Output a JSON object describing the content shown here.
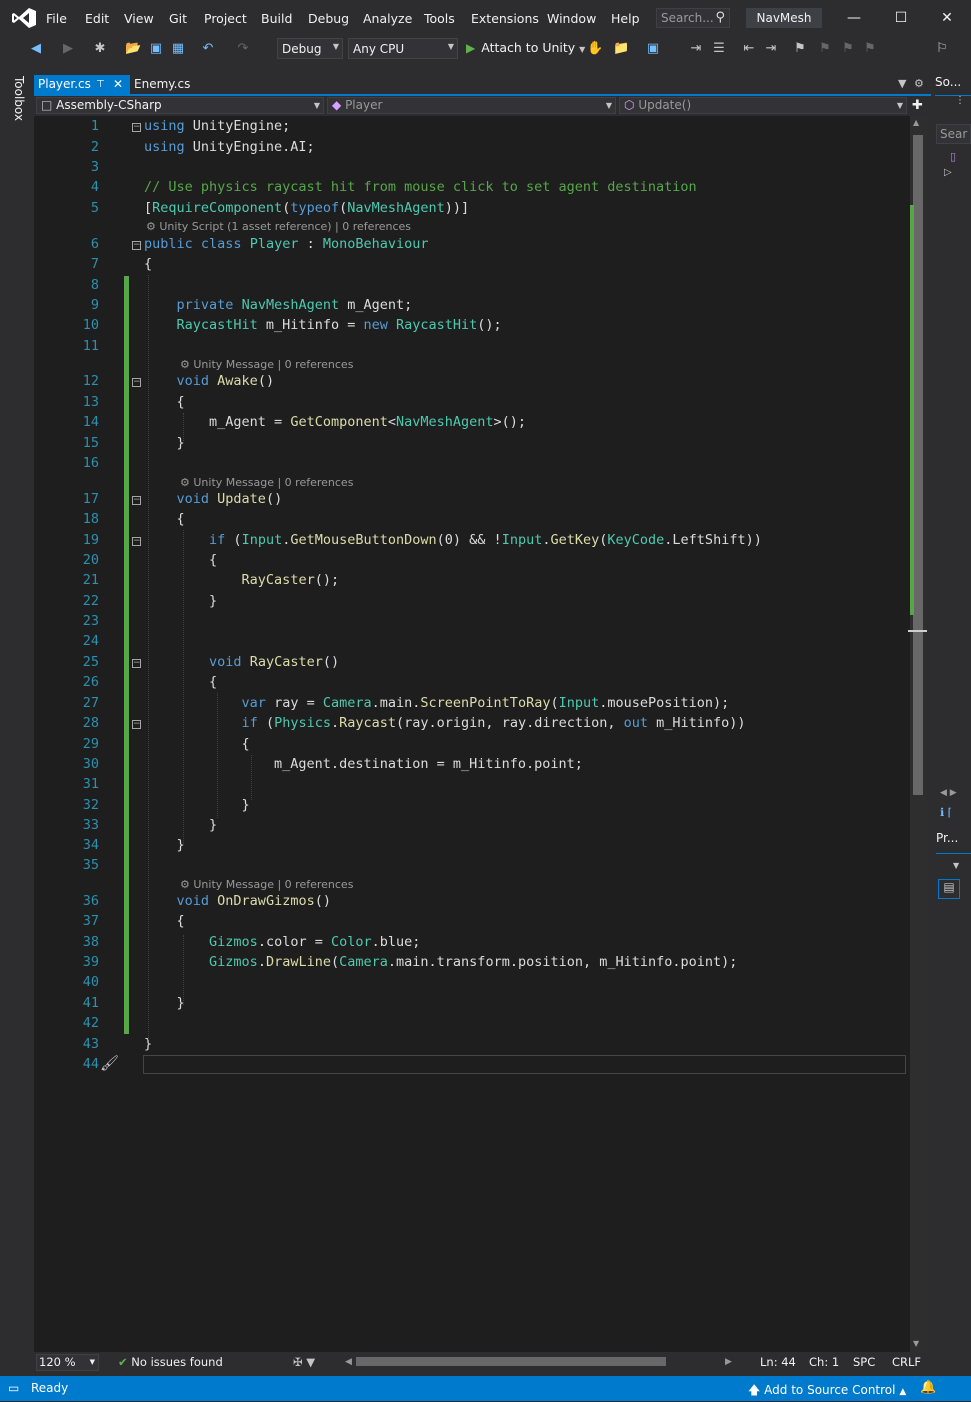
{
  "menu": [
    "File",
    "Edit",
    "View",
    "Git",
    "Project",
    "Build",
    "Debug",
    "Analyze",
    "Tools",
    "Extensions",
    "Window",
    "Help"
  ],
  "search_placeholder": "Search...",
  "solution_name": "NavMesh",
  "toolbar": {
    "config": "Debug",
    "platform": "Any CPU",
    "attach": "Attach to Unity"
  },
  "toolbox_label": "Toolbox",
  "tabs": [
    {
      "label": "Player.cs",
      "active": true
    },
    {
      "label": "Enemy.cs",
      "active": false
    }
  ],
  "navbar": {
    "project": "Assembly-CSharp",
    "type": "Player",
    "member": "Update()"
  },
  "code_lines": [
    "using UnityEngine;",
    "using UnityEngine.AI;",
    "",
    "// Use physics raycast hit from mouse click to set agent destination",
    "[RequireComponent(typeof(NavMeshAgent))]",
    "public class Player : MonoBehaviour",
    "{",
    "",
    "    private NavMeshAgent m_Agent;",
    "    RaycastHit m_Hitinfo = new RaycastHit();",
    "",
    "    void Awake()",
    "    {",
    "        m_Agent = GetComponent<NavMeshAgent>();",
    "    }",
    "",
    "    void Update()",
    "    {",
    "        if (Input.GetMouseButtonDown(0) && !Input.GetKey(KeyCode.LeftShift))",
    "        {",
    "            RayCaster();",
    "        }",
    "",
    "",
    "        void RayCaster()",
    "        {",
    "            var ray = Camera.main.ScreenPointToRay(Input.mousePosition);",
    "            if (Physics.Raycast(ray.origin, ray.direction, out m_Hitinfo))",
    "            {",
    "                m_Agent.destination = m_Hitinfo.point;",
    "",
    "            }",
    "        }",
    "    }",
    "",
    "    void OnDrawGizmos()",
    "    {",
    "        Gizmos.color = Color.blue;",
    "        Gizmos.DrawLine(Camera.main.transform.position, m_Hitinfo.point);",
    "",
    "    }",
    "",
    "}",
    ""
  ],
  "codelens": {
    "class": "Unity Script (1 asset reference) | 0 references",
    "awake": "Unity Message | 0 references",
    "update": "Unity Message | 0 references",
    "gizmos": "Unity Message | 0 references"
  },
  "editor_status": {
    "zoom": "120 %",
    "issues": "No issues found",
    "line": "Ln: 44",
    "char": "Ch: 1",
    "spacing": "SPC",
    "eol": "CRLF"
  },
  "right_panel": {
    "solution_tab": "So...",
    "search": "Sear",
    "properties_tab": "Pr..."
  },
  "status": {
    "ready": "Ready",
    "source_control": "Add to Source Control"
  }
}
